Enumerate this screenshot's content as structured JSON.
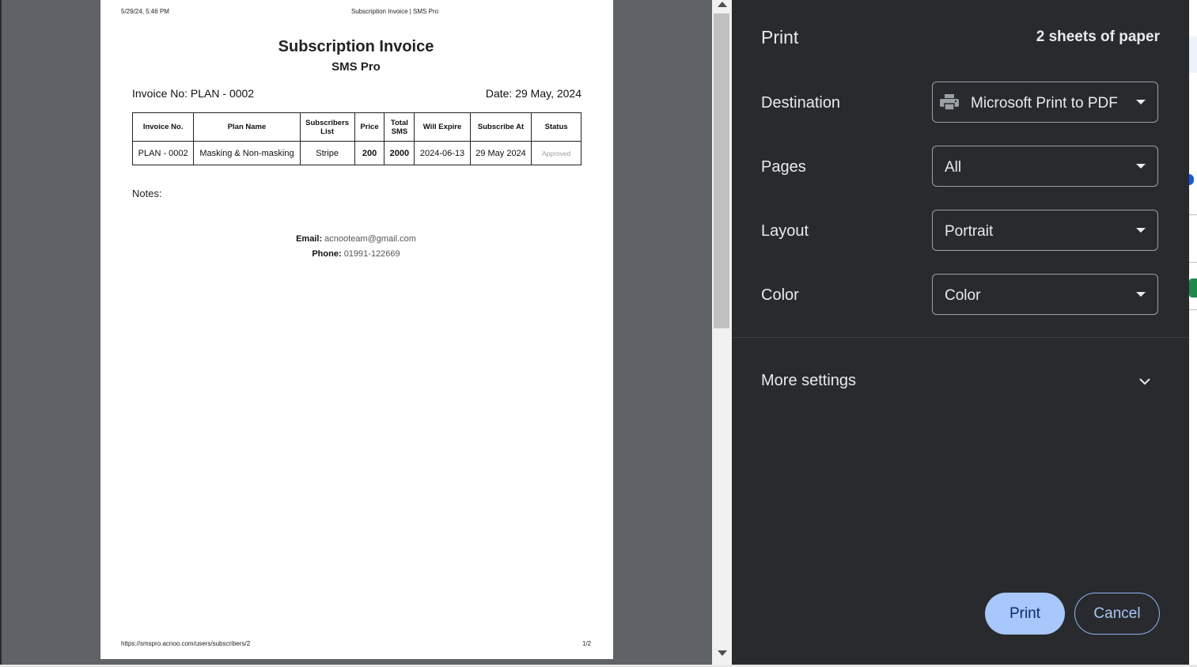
{
  "document": {
    "header_datetime": "5/29/24, 5:46 PM",
    "header_title": "Subscription Invoice | SMS Pro",
    "title": "Subscription Invoice",
    "subtitle": "SMS Pro",
    "invoice_no": "Invoice No: PLAN - 0002",
    "date": "Date: 29 May, 2024",
    "table": {
      "headers": [
        "Invoice No.",
        "Plan Name",
        "Subscribers List",
        "Price",
        "Total SMS",
        "Will Expire",
        "Subscribe At",
        "Status"
      ],
      "rows": [
        [
          "PLAN - 0002",
          "Masking & Non-masking",
          "Stripe",
          "200",
          "2000",
          "2024-06-13",
          "29 May 2024",
          "Approved"
        ]
      ]
    },
    "notes_label": "Notes:",
    "email_label": "Email:",
    "email_value": "acnooteam@gmail.com",
    "phone_label": "Phone:",
    "phone_value": "01991-122669",
    "footer_url": "https://smspro.acnoo.com/users/subscribers/2",
    "footer_page": "1/2"
  },
  "print_panel": {
    "title": "Print",
    "sheets": "2 sheets of paper",
    "destination": {
      "label": "Destination",
      "value": "Microsoft Print to PDF",
      "icon": "printer-icon"
    },
    "pages": {
      "label": "Pages",
      "value": "All"
    },
    "layout": {
      "label": "Layout",
      "value": "Portrait"
    },
    "color": {
      "label": "Color",
      "value": "Color"
    },
    "more_settings": "More settings",
    "print_button": "Print",
    "cancel_button": "Cancel"
  },
  "colors": {
    "panel_bg": "#292a2d",
    "preview_bg": "#5f6368",
    "print_button_bg": "#a8c7fa",
    "cancel_border": "#8ab4f8"
  }
}
